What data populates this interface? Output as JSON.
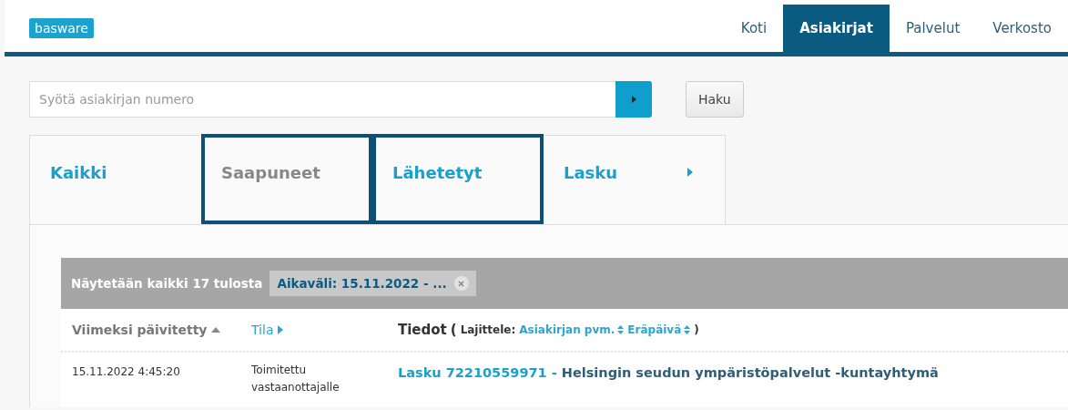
{
  "header": {
    "logo": "basware",
    "nav": [
      {
        "label": "Koti",
        "selected": false
      },
      {
        "label": "Asiakirjat",
        "selected": true
      },
      {
        "label": "Palvelut",
        "selected": false
      },
      {
        "label": "Verkosto",
        "selected": false
      }
    ]
  },
  "search": {
    "placeholder": "Syötä asiakirjan numero",
    "button": "Haku"
  },
  "tabs": [
    {
      "label": "Kaikki",
      "selected": false,
      "outlined": false,
      "arrow": false
    },
    {
      "label": "Saapuneet",
      "selected": true,
      "outlined": true,
      "arrow": false
    },
    {
      "label": "Lähetetyt",
      "selected": false,
      "outlined": true,
      "arrow": false
    },
    {
      "label": "Lasku",
      "selected": false,
      "outlined": false,
      "arrow": true
    }
  ],
  "results": {
    "summary": "Näytetään kaikki 17 tulosta",
    "filter": "Aikaväli: 15.11.2022 - ...",
    "columns": {
      "updated": "Viimeksi päivitetty",
      "status": "Tila",
      "details": "Tiedot",
      "open_paren": "(",
      "sort_label": "Lajittele:",
      "sort_options": [
        "Asiakirjan pvm.",
        "Eräpäivä"
      ],
      "close_paren": ")"
    },
    "rows": [
      {
        "updated": "15.11.2022 4:45:20",
        "status": "Toimitettu vastaanottajalle",
        "link": "Lasku 72210559971 - ",
        "party": "Helsingin seudun ympäristöpalvelut -kuntayhtymä"
      }
    ]
  }
}
